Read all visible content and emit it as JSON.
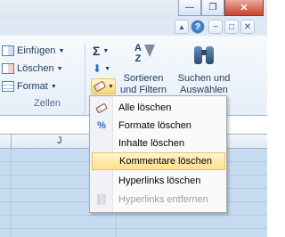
{
  "window": {
    "minimize_glyph": "—",
    "restore_glyph": "❐",
    "close_glyph": "✕"
  },
  "ribbon_header": {
    "help_glyph": "?",
    "nav_glyphs": [
      "▲",
      "◆",
      "−",
      "□",
      "✕"
    ]
  },
  "cells_group": {
    "insert_label": "Einfügen",
    "delete_label": "Löschen",
    "format_label": "Format",
    "group_label": "Zellen"
  },
  "editing_group": {
    "sum_glyph": "Σ",
    "fill_glyph": "⬇",
    "sort_label_line1": "Sortieren",
    "sort_label_line2": "und Filtern",
    "find_label_line1": "Suchen und",
    "find_label_line2": "Auswählen",
    "sort_icon_text": "AZ"
  },
  "sheet": {
    "column_label": "J"
  },
  "clear_menu": {
    "items": [
      {
        "label": "Alle löschen",
        "icon": "eraser-icon"
      },
      {
        "label": "Formate löschen",
        "icon": "format-clear-icon"
      },
      {
        "label": "Inhalte löschen",
        "icon": "none"
      },
      {
        "label": "Kommentare löschen",
        "icon": "none"
      },
      {
        "label": "Hyperlinks löschen",
        "icon": "none"
      },
      {
        "label": "Hyperlinks entfernen",
        "icon": "unlink-icon"
      }
    ],
    "highlighted_index": 3,
    "disabled_index": 5
  },
  "colors": {
    "ribbon_bg": "#e6eef8",
    "sheet_bg": "#c7dbf0",
    "menu_hover": "#ffe08a",
    "text": "#1e395b"
  }
}
